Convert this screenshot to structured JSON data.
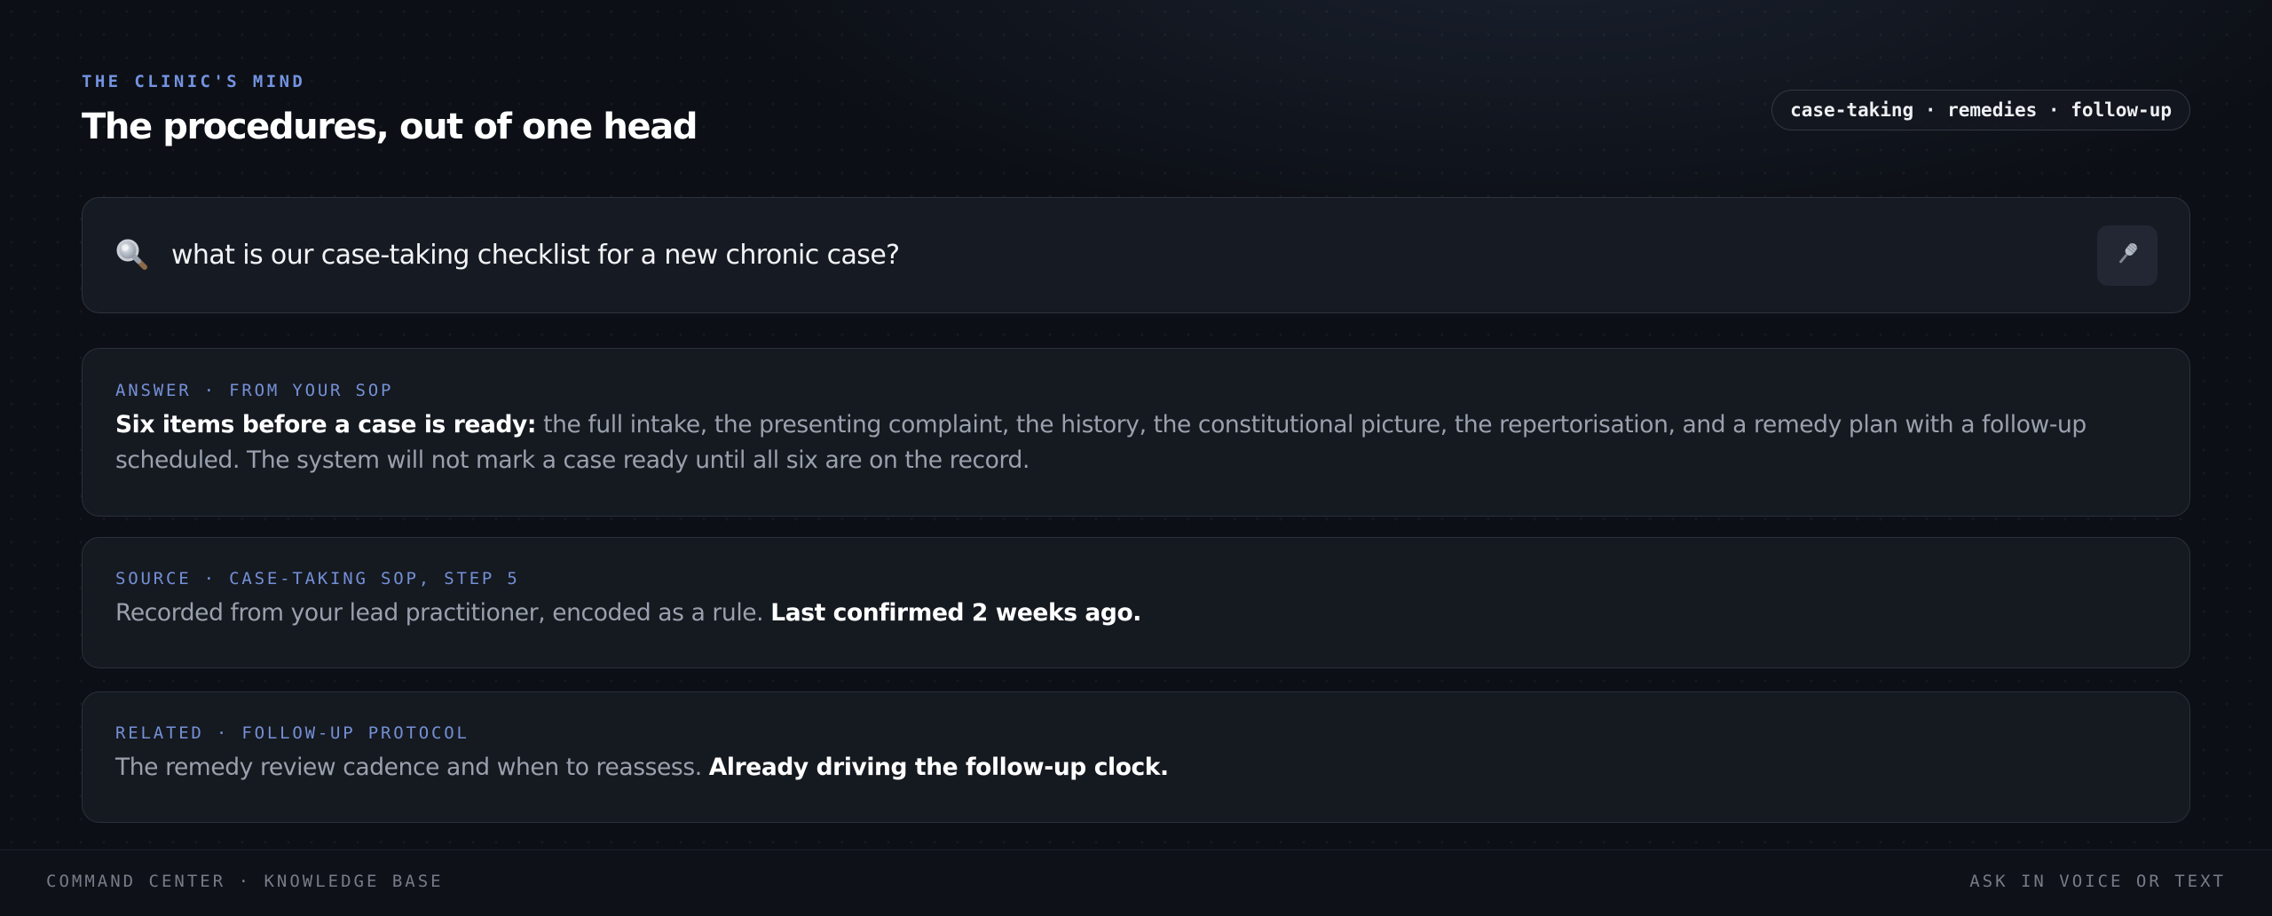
{
  "header": {
    "eyebrow": "THE CLINIC'S MIND",
    "title": "The procedures, out of one head",
    "chip": "case-taking · remedies · follow-up"
  },
  "search": {
    "icon": "search-icon",
    "value": "what is our case-taking checklist for a new chronic case?",
    "mic_icon": "microphone-icon"
  },
  "cards": {
    "answer": {
      "label": "ANSWER · FROM YOUR SOP",
      "bold": "Six items before a case is ready:",
      "text": " the full intake, the presenting complaint, the history, the constitutional picture, the repertorisation, and a remedy plan with a follow-up scheduled. The system will not mark a case ready until all six are on the record."
    },
    "source": {
      "label": "SOURCE · CASE-TAKING SOP, STEP 5",
      "text": "Recorded from your lead practitioner, encoded as a rule. ",
      "bold": "Last confirmed 2 weeks ago."
    },
    "related": {
      "label": "RELATED · FOLLOW-UP PROTOCOL",
      "text": "The remedy review cadence and when to reassess. ",
      "bold": "Already driving the follow-up clock."
    }
  },
  "footer": {
    "left": "COMMAND CENTER · KNOWLEDGE BASE",
    "right": "ASK IN VOICE OR TEXT"
  },
  "colors": {
    "accent": "#7393e0",
    "background": "#0c0f15",
    "card": "#151920"
  }
}
